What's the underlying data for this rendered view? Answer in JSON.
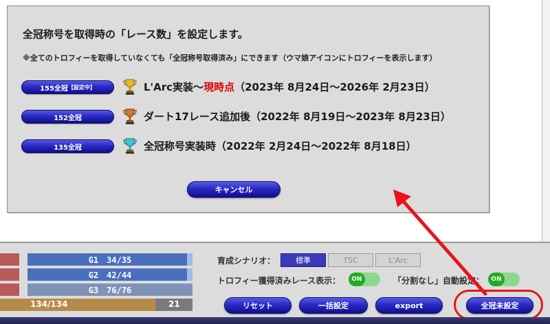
{
  "modal": {
    "title": "全冠称号を取得時の「レース数」を設定します。",
    "note": "※全てのトロフィーを取得していなくても「全冠称号取得済み」にできます（ウマ娘アイコンにトロフィーを表示します）",
    "options": [
      {
        "button_label": "155全冠",
        "button_tag": "【設定中】",
        "trophy": "gold-trophy-icon",
        "text_before": "L'Arc実装～",
        "text_highlight": "現時点",
        "text_after": "（2023年 8月24日～2026年 2月23日）"
      },
      {
        "button_label": "152全冠",
        "trophy": "bronze-trophy-icon",
        "text": "ダート17レース追加後（2022年 8月19日～2023年 8月23日）"
      },
      {
        "button_label": "135全冠",
        "trophy": "teal-trophy-icon",
        "text": "全冠称号実装時（2022年 2月24日～2022年 8月18日）"
      }
    ],
    "cancel_label": "キャンセル"
  },
  "stats": {
    "g1": "G1　34/35",
    "g2": "G2　42/44",
    "g3": "G3　76/76",
    "total": "134/134",
    "total_rest": "21"
  },
  "scenario": {
    "label": "育成シナリオ：",
    "options": [
      "標準",
      "TSC",
      "L'Arc"
    ]
  },
  "toggles": {
    "trophy_races_label": "トロフィー獲得済みレース表示：",
    "trophy_races_value": "ON",
    "no_split_label": "「分割なし」自動設定：",
    "no_split_value": "ON"
  },
  "buttons": {
    "reset": "リセット",
    "bulk": "一括設定",
    "export": "export",
    "unset": "全冠未設定"
  },
  "colors": {
    "button_blue": "#2a2ac4",
    "highlight_red": "#e00000",
    "annotation_red": "#e8141a",
    "toggle_green": "#22aa22"
  }
}
